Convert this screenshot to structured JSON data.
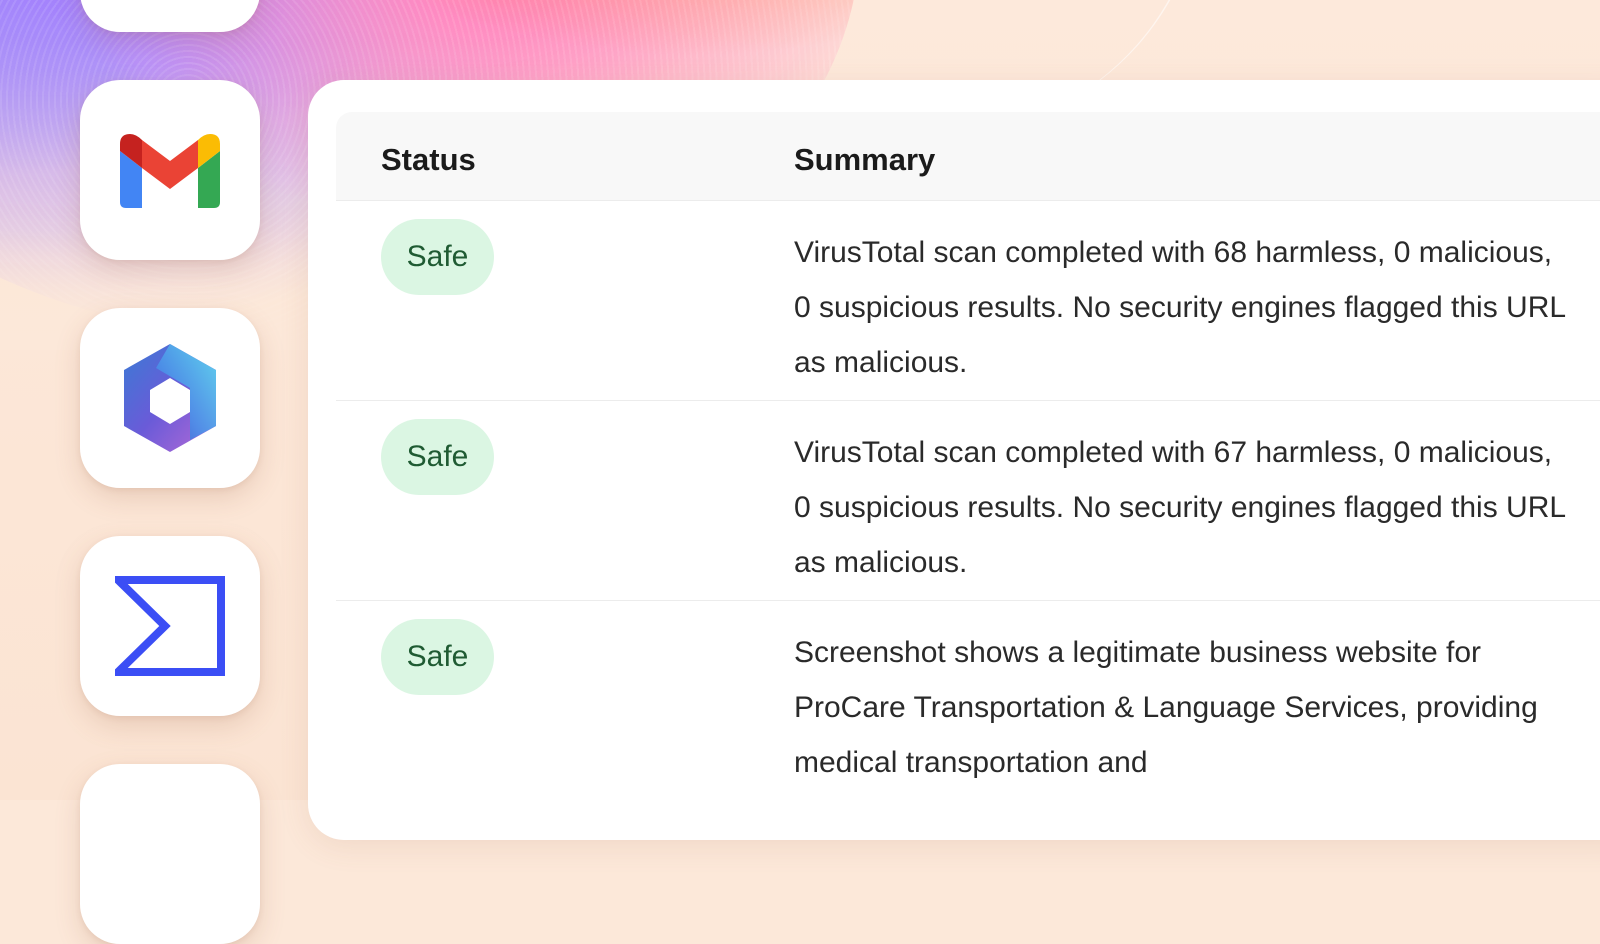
{
  "table": {
    "headers": {
      "status": "Status",
      "summary": "Summary"
    },
    "rows": [
      {
        "status": "Safe",
        "summary": "VirusTotal scan completed with 68 harmless, 0 malicious, 0 suspicious results. No security engines flagged this URL as malicious."
      },
      {
        "status": "Safe",
        "summary": "VirusTotal scan completed with 67 harmless, 0 malicious, 0 suspicious results. No security engines flagged this URL as malicious."
      },
      {
        "status": "Safe",
        "summary": "Screenshot shows a legitimate business website for ProCare Transportation & Language Services, providing medical transportation and"
      }
    ]
  },
  "dock": {
    "apps": [
      {
        "icon": "app-tile-icon"
      },
      {
        "icon": "gmail-icon"
      },
      {
        "icon": "microsoft-365-icon"
      },
      {
        "icon": "sigma-icon"
      },
      {
        "icon": "app-tile-icon"
      }
    ]
  },
  "colors": {
    "safe_badge_bg": "#dbf6e3",
    "safe_badge_text": "#1f5b33",
    "background": "#fce8d9"
  }
}
